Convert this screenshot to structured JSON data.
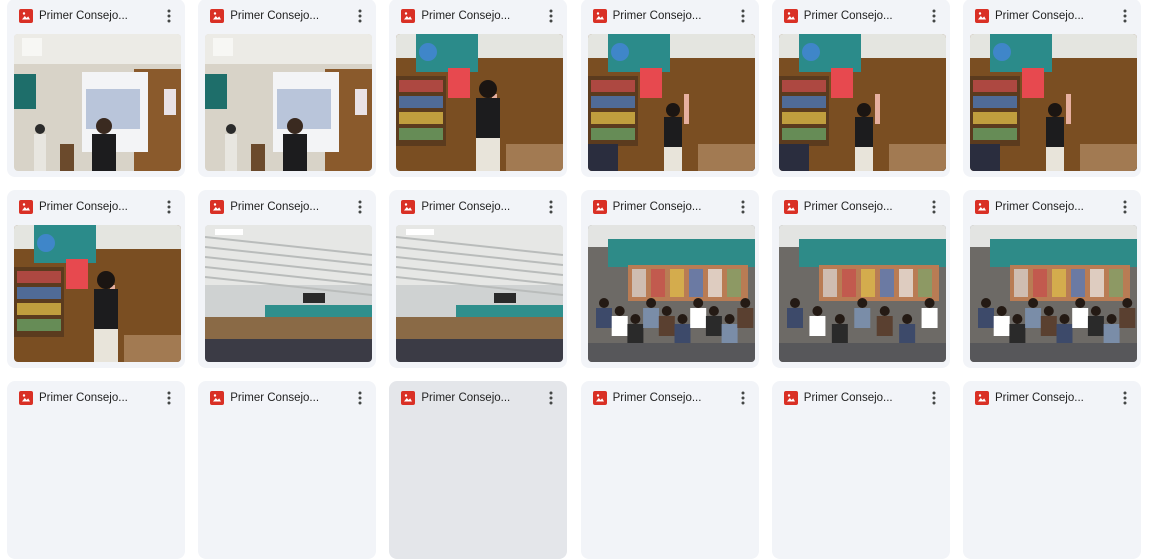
{
  "icons": {
    "file": "image-file-icon",
    "menu": "more-vert-icon"
  },
  "colors": {
    "file_icon": "#d93025",
    "card_bg": "#f2f4f8",
    "card_hover_bg": "#e4e6ea"
  },
  "files": [
    {
      "title": "Primer Consejo...",
      "scene": "projector"
    },
    {
      "title": "Primer Consejo...",
      "scene": "projector"
    },
    {
      "title": "Primer Consejo...",
      "scene": "library-speaker"
    },
    {
      "title": "Primer Consejo...",
      "scene": "library-wide"
    },
    {
      "title": "Primer Consejo...",
      "scene": "library-wide"
    },
    {
      "title": "Primer Consejo...",
      "scene": "library-wide"
    },
    {
      "title": "Primer Consejo...",
      "scene": "library-speaker"
    },
    {
      "title": "Primer Consejo...",
      "scene": "hall-ceiling"
    },
    {
      "title": "Primer Consejo...",
      "scene": "hall-ceiling"
    },
    {
      "title": "Primer Consejo...",
      "scene": "audience"
    },
    {
      "title": "Primer Consejo...",
      "scene": "audience-close"
    },
    {
      "title": "Primer Consejo...",
      "scene": "audience"
    },
    {
      "title": "Primer Consejo...",
      "scene": "none"
    },
    {
      "title": "Primer Consejo...",
      "scene": "none"
    },
    {
      "title": "Primer Consejo...",
      "scene": "none",
      "hover": true
    },
    {
      "title": "Primer Consejo...",
      "scene": "none"
    },
    {
      "title": "Primer Consejo...",
      "scene": "none"
    },
    {
      "title": "Primer Consejo...",
      "scene": "none"
    }
  ]
}
